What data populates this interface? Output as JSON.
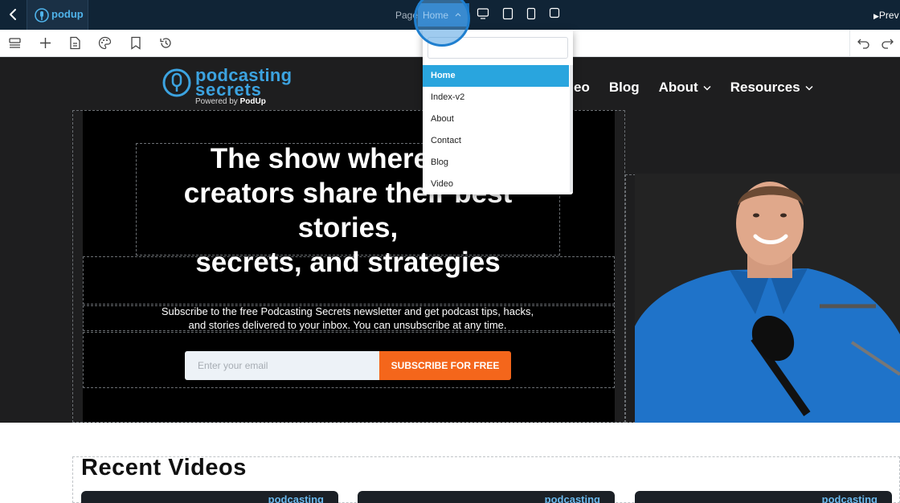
{
  "topbar": {
    "logo_text": "podup",
    "page_label": "Page:",
    "selected_page": "Home",
    "preview_label": "Prev"
  },
  "dropdown": {
    "search_placeholder": "",
    "pages": [
      "Home",
      "Index-v2",
      "About",
      "Contact",
      "Blog",
      "Video"
    ],
    "active_index": 0
  },
  "site": {
    "logo": {
      "line1": "podcasting",
      "line2": "secrets",
      "powered_prefix": "Powered by ",
      "powered_brand": "PodUp"
    },
    "nav": [
      {
        "label": "eo",
        "has_dropdown": false
      },
      {
        "label": "Blog",
        "has_dropdown": false
      },
      {
        "label": "About",
        "has_dropdown": true
      },
      {
        "label": "Resources",
        "has_dropdown": true
      }
    ],
    "headline": "The show where successful creators share their best stories, secrets, and strategies",
    "headline_visible": [
      "The show where suc",
      "creators share their best stories,",
      "secrets, and strategies"
    ],
    "subscribe_text_line1": "Subscribe to the free Podcasting Secrets newsletter and get podcast tips, hacks,",
    "subscribe_text_line2": "and stories delivered to your inbox. You can unsubscribe at any time.",
    "email_placeholder": "Enter your email",
    "subscribe_button": "SUBSCRIBE FOR FREE",
    "recent_videos_title": "Recent Videos",
    "card_logo": "podcasting"
  },
  "colors": {
    "topbar_bg": "#102436",
    "accent_blue": "#29a5de",
    "subscribe_orange": "#f4661b",
    "hero_bg": "#1e1e1f"
  }
}
